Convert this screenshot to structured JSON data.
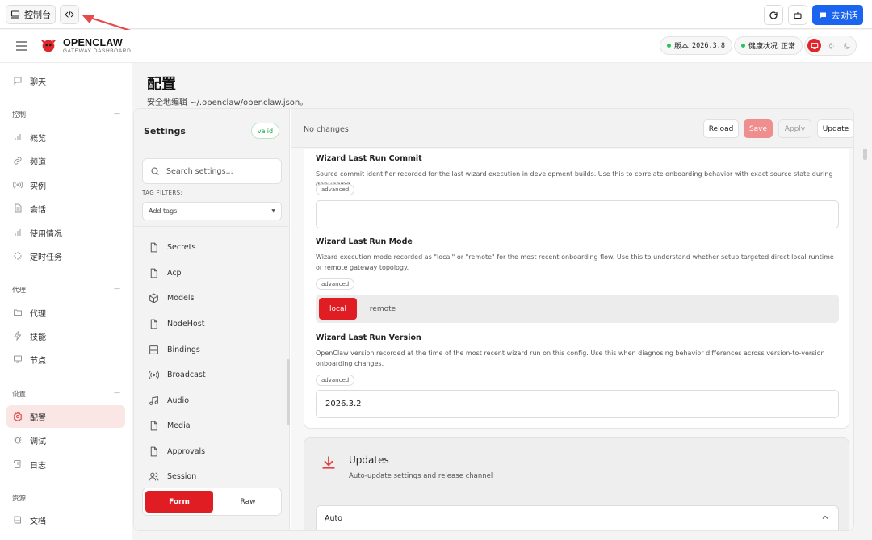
{
  "topbar": {
    "console_label": "控制台",
    "go_chat_label": "去对话"
  },
  "header": {
    "brand": "OPENCLAW",
    "brand_sub": "GATEWAY DASHBOARD",
    "version_label": "版本",
    "version_value": "2026.3.8",
    "health_label": "健康状况",
    "health_value": "正常"
  },
  "sidebar": {
    "chat": "聊天",
    "groups": [
      {
        "title": "控制",
        "items": [
          {
            "label": "概览",
            "icon": "bar-chart-icon"
          },
          {
            "label": "频道",
            "icon": "link-icon"
          },
          {
            "label": "实例",
            "icon": "radio-icon"
          },
          {
            "label": "会话",
            "icon": "file-text-icon"
          },
          {
            "label": "使用情况",
            "icon": "bar-chart-icon"
          },
          {
            "label": "定时任务",
            "icon": "loader-icon"
          }
        ]
      },
      {
        "title": "代理",
        "items": [
          {
            "label": "代理",
            "icon": "folder-icon"
          },
          {
            "label": "技能",
            "icon": "zap-icon"
          },
          {
            "label": "节点",
            "icon": "monitor-icon"
          }
        ]
      },
      {
        "title": "设置",
        "items": [
          {
            "label": "配置",
            "icon": "settings-icon"
          },
          {
            "label": "调试",
            "icon": "bug-icon"
          },
          {
            "label": "日志",
            "icon": "scroll-icon"
          }
        ]
      },
      {
        "title": "资源",
        "items": [
          {
            "label": "文档",
            "icon": "book-icon"
          }
        ]
      }
    ]
  },
  "page": {
    "title": "配置",
    "subtitle": "安全地编辑 ~/.openclaw/openclaw.json。"
  },
  "settings": {
    "title": "Settings",
    "status": "valid",
    "search_placeholder": "Search settings...",
    "tag_filters_label": "TAG FILTERS:",
    "tags_placeholder": "Add tags",
    "sections": [
      "Secrets",
      "Acp",
      "Models",
      "NodeHost",
      "Bindings",
      "Broadcast",
      "Audio",
      "Media",
      "Approvals",
      "Session"
    ],
    "mode_form": "Form",
    "mode_raw": "Raw"
  },
  "actions": {
    "status": "No changes",
    "reload": "Reload",
    "save": "Save",
    "apply": "Apply",
    "update": "Update"
  },
  "fields": {
    "commit": {
      "title": "Wizard Last Run Commit",
      "desc": "Source commit identifier recorded for the last wizard execution in development builds. Use this to correlate onboarding behavior with exact source state during debugging.",
      "tag": "advanced",
      "value": ""
    },
    "mode": {
      "title": "Wizard Last Run Mode",
      "desc": "Wizard execution mode recorded as \"local\" or \"remote\" for the most recent onboarding flow. Use this to understand whether setup targeted direct local runtime or remote gateway topology.",
      "tag": "advanced",
      "options": [
        "local",
        "remote"
      ],
      "selected": "local"
    },
    "version": {
      "title": "Wizard Last Run Version",
      "desc": "OpenClaw version recorded at the time of the most recent wizard run on this config. Use this when diagnosing behavior differences across version-to-version onboarding changes.",
      "tag": "advanced",
      "value": "2026.3.2"
    }
  },
  "updates": {
    "title": "Updates",
    "subtitle": "Auto-update settings and release channel",
    "auto_label": "Auto"
  },
  "colors": {
    "accent": "#e11d24",
    "primary_blue": "#1a64f0",
    "status_green": "#22c55e"
  }
}
